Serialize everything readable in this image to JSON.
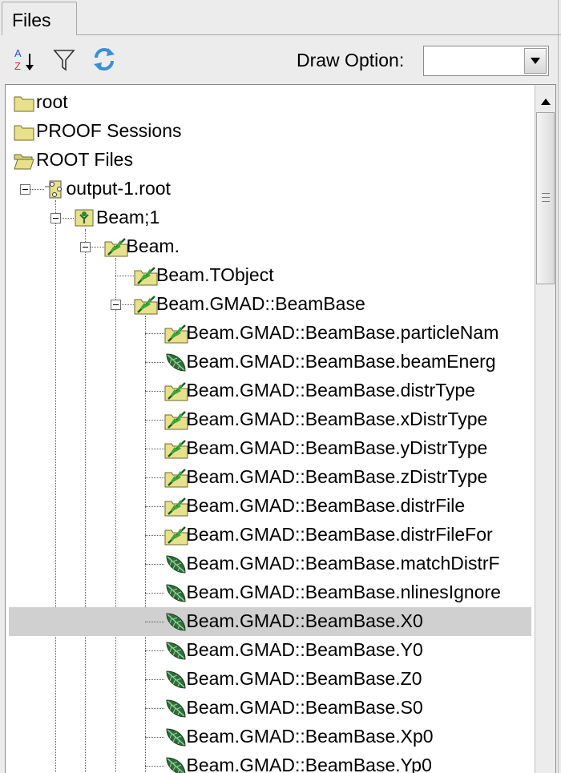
{
  "tabs": [
    {
      "label": "Files"
    }
  ],
  "toolbar": {
    "sort_icon": "sort-az-icon",
    "filter_icon": "filter-icon",
    "refresh_icon": "refresh-icon",
    "draw_option_label": "Draw Option:",
    "draw_option_value": ""
  },
  "tree": {
    "items": [
      {
        "label": "root",
        "icon": "folder-icon",
        "depth": 0
      },
      {
        "label": "PROOF Sessions",
        "icon": "folder-icon",
        "depth": 0
      },
      {
        "label": "ROOT Files",
        "icon": "open-folder-icon",
        "depth": 0
      },
      {
        "label": "output-1.root",
        "icon": "root-file-icon",
        "depth": 1,
        "expanded": true
      },
      {
        "label": "Beam;1",
        "icon": "ttree-icon",
        "depth": 2,
        "expanded": true
      },
      {
        "label": "Beam.",
        "icon": "branch-folder-icon",
        "depth": 3,
        "expanded": true
      },
      {
        "label": "Beam.TObject",
        "icon": "branch-folder-icon",
        "depth": 4
      },
      {
        "label": "Beam.GMAD::BeamBase",
        "icon": "branch-folder-icon",
        "depth": 4,
        "expanded": true
      },
      {
        "label": "Beam.GMAD::BeamBase.particleNam",
        "icon": "branch-folder-icon",
        "depth": 5
      },
      {
        "label": "Beam.GMAD::BeamBase.beamEnerg",
        "icon": "leaf-icon",
        "depth": 5
      },
      {
        "label": "Beam.GMAD::BeamBase.distrType",
        "icon": "branch-folder-icon",
        "depth": 5
      },
      {
        "label": "Beam.GMAD::BeamBase.xDistrType",
        "icon": "branch-folder-icon",
        "depth": 5
      },
      {
        "label": "Beam.GMAD::BeamBase.yDistrType",
        "icon": "branch-folder-icon",
        "depth": 5
      },
      {
        "label": "Beam.GMAD::BeamBase.zDistrType",
        "icon": "branch-folder-icon",
        "depth": 5
      },
      {
        "label": "Beam.GMAD::BeamBase.distrFile",
        "icon": "branch-folder-icon",
        "depth": 5
      },
      {
        "label": "Beam.GMAD::BeamBase.distrFileFor",
        "icon": "branch-folder-icon",
        "depth": 5
      },
      {
        "label": "Beam.GMAD::BeamBase.matchDistrF",
        "icon": "leaf-icon",
        "depth": 5
      },
      {
        "label": "Beam.GMAD::BeamBase.nlinesIgnore",
        "icon": "leaf-icon",
        "depth": 5
      },
      {
        "label": "Beam.GMAD::BeamBase.X0",
        "icon": "leaf-icon",
        "depth": 5,
        "selected": true
      },
      {
        "label": "Beam.GMAD::BeamBase.Y0",
        "icon": "leaf-icon",
        "depth": 5
      },
      {
        "label": "Beam.GMAD::BeamBase.Z0",
        "icon": "leaf-icon",
        "depth": 5
      },
      {
        "label": "Beam.GMAD::BeamBase.S0",
        "icon": "leaf-icon",
        "depth": 5
      },
      {
        "label": "Beam.GMAD::BeamBase.Xp0",
        "icon": "leaf-icon",
        "depth": 5
      },
      {
        "label": "Beam.GMAD::BeamBase.Yp0",
        "icon": "leaf-icon",
        "depth": 5
      }
    ]
  },
  "colors": {
    "selection": "#d0d0d0",
    "folder": "#e8e08a",
    "leaf": "#2e6e3a",
    "branch_accent": "#3aa83a"
  }
}
